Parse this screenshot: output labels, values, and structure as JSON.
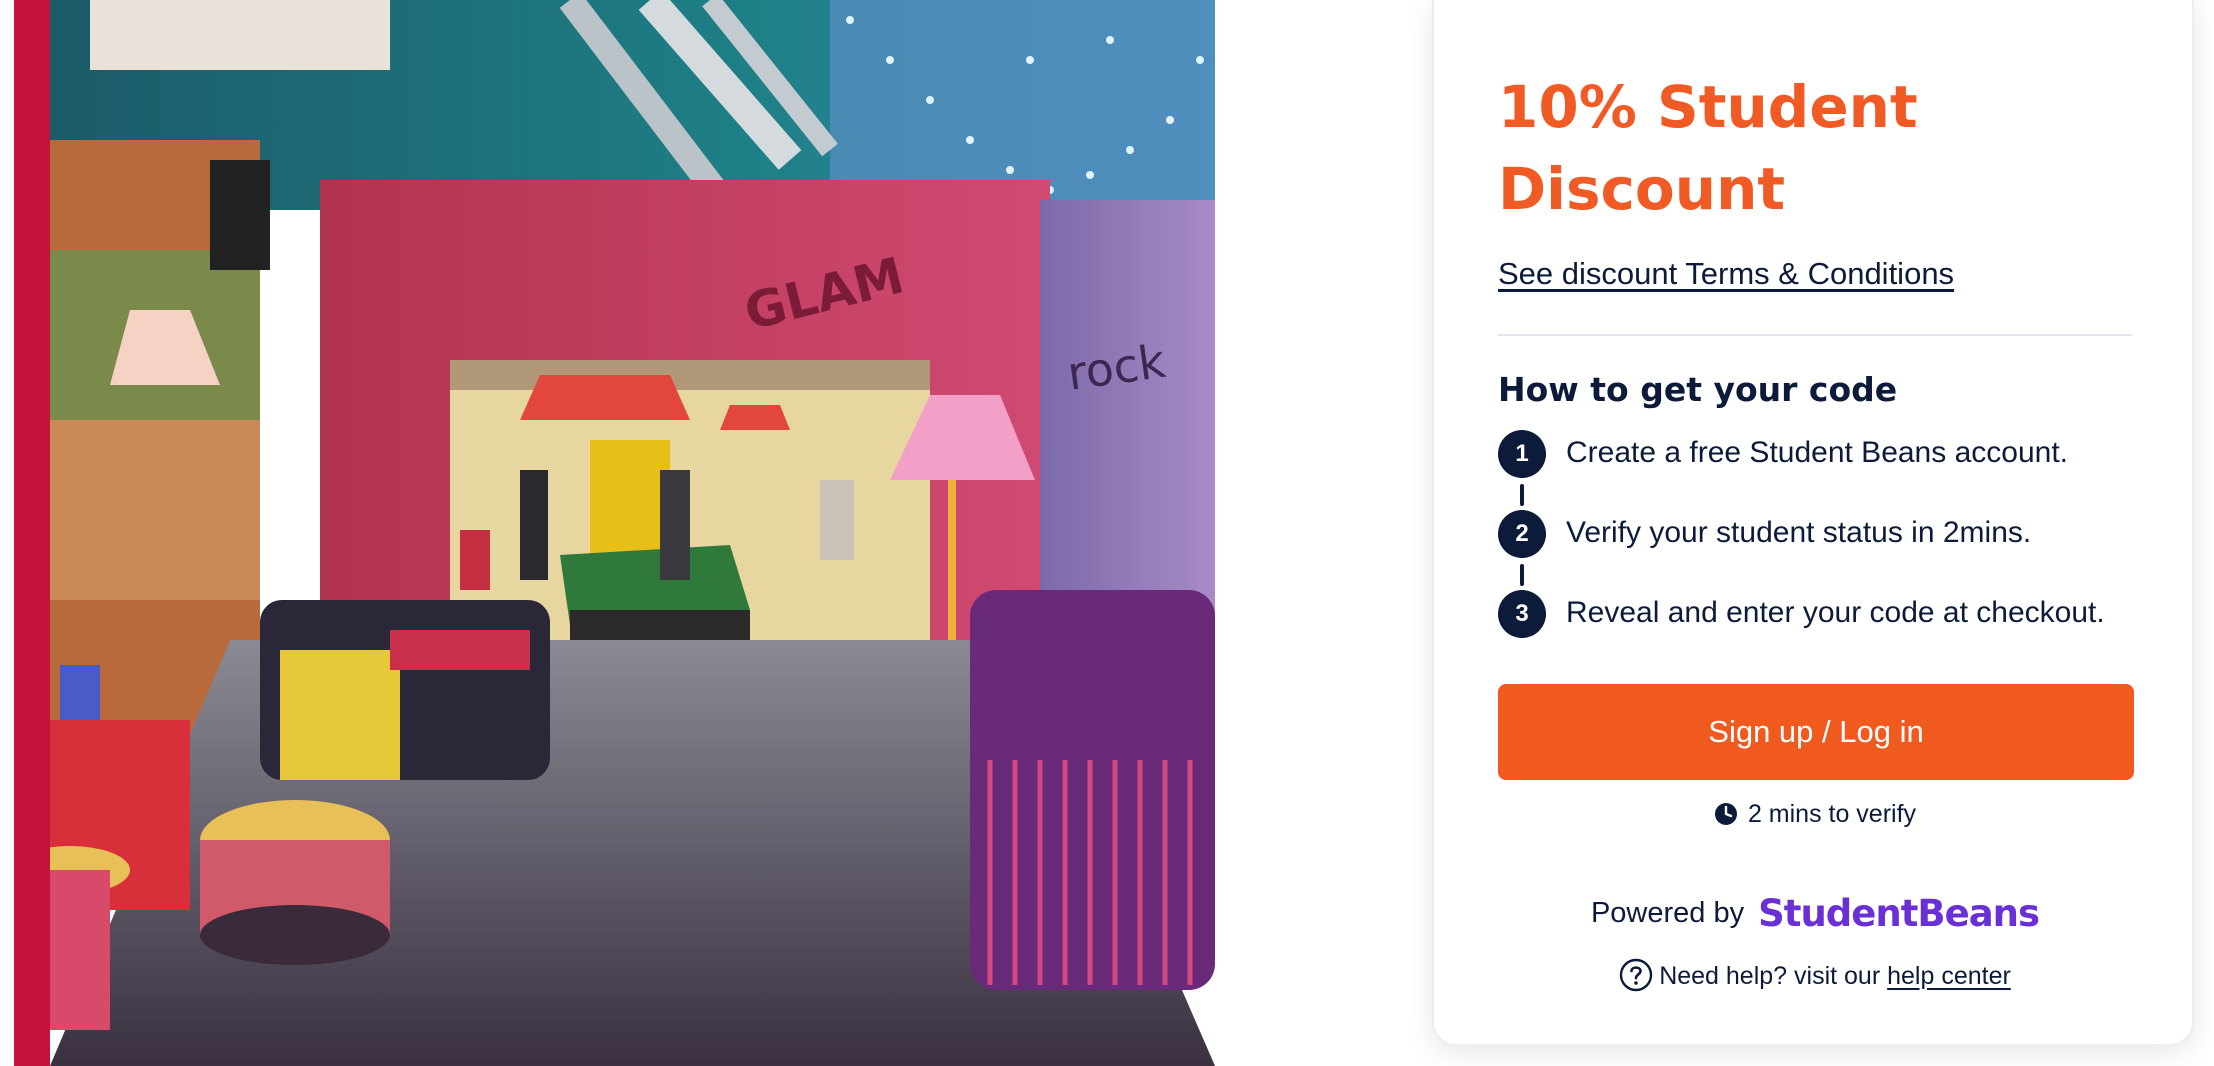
{
  "offer": {
    "title": "10% Student Discount",
    "terms_link": "See discount Terms & Conditions"
  },
  "how_to": {
    "heading": "How to get your code",
    "steps": [
      {
        "number": "1",
        "text": "Create a free Student Beans account."
      },
      {
        "number": "2",
        "text": "Verify your student status in 2mins."
      },
      {
        "number": "3",
        "text": "Reveal and enter your code at checkout."
      }
    ]
  },
  "cta": {
    "label": "Sign up / Log in",
    "verify_note": "2 mins to verify"
  },
  "footer": {
    "powered_by": "Powered by",
    "brand": "StudentBeans",
    "help_prefix": "Need help? visit our",
    "help_link": "help center"
  },
  "photo": {
    "wall_text_1": "GLAM",
    "wall_text_2": "rock"
  },
  "colors": {
    "accent": "#f05a24",
    "navy": "#0c1b3a",
    "brand_purple": "#6b2fd6"
  },
  "icons": [
    "clock-icon",
    "help-circle-icon"
  ]
}
